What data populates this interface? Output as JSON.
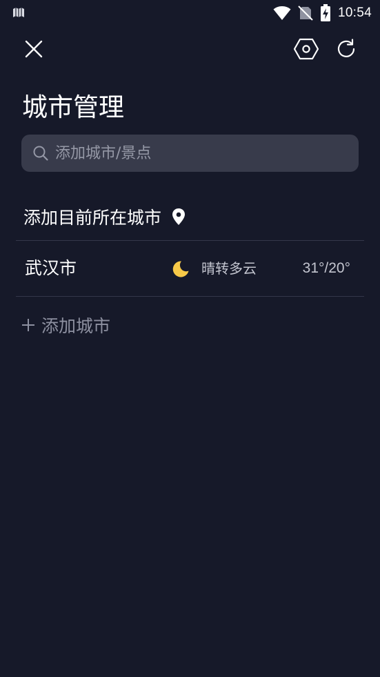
{
  "status_bar": {
    "time": "10:54",
    "icons": [
      "map-icon",
      "wifi-icon",
      "no-sim-icon",
      "battery-charging-icon"
    ]
  },
  "toolbar": {
    "close_icon": "close-icon",
    "settings_icon": "hexagon-settings-icon",
    "refresh_icon": "refresh-icon"
  },
  "page": {
    "title": "城市管理"
  },
  "search": {
    "placeholder": "添加城市/景点",
    "value": ""
  },
  "locate": {
    "label": "添加目前所在城市",
    "icon": "location-pin-icon"
  },
  "cities": [
    {
      "name": "武汉市",
      "weather_icon": "moon-icon",
      "weather": "晴转多云",
      "temperature": "31°/20°"
    }
  ],
  "add_city": {
    "label": "添加城市",
    "icon": "plus-icon"
  },
  "colors": {
    "background": "#161929",
    "search_bg": "#383b4b",
    "divider": "#34374a",
    "moon": "#f7c948",
    "muted_text": "#8d90a0"
  }
}
